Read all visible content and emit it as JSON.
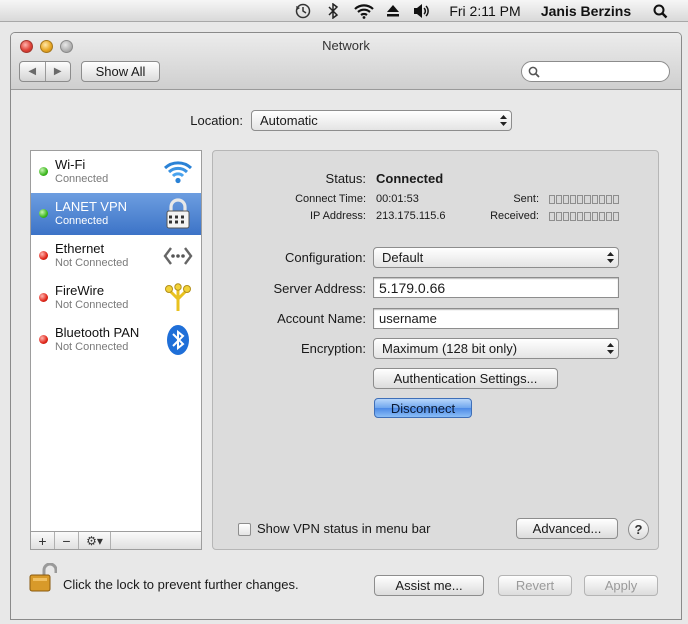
{
  "menubar": {
    "clock": "Fri 2:11 PM",
    "user": "Janis Berzins",
    "icons": [
      "time-machine-icon",
      "bluetooth-icon",
      "wifi-icon",
      "eject-icon",
      "volume-icon",
      "spotlight-icon"
    ]
  },
  "window": {
    "title": "Network",
    "show_all": "Show All",
    "search_placeholder": ""
  },
  "location": {
    "label": "Location:",
    "value": "Automatic"
  },
  "services": [
    {
      "name": "Wi-Fi",
      "status": "Connected",
      "state": "green",
      "icon": "wifi-icon"
    },
    {
      "name": "LANET VPN",
      "status": "Connected",
      "state": "green",
      "icon": "vpn-lock-icon",
      "selected": true
    },
    {
      "name": "Ethernet",
      "status": "Not Connected",
      "state": "red",
      "icon": "ethernet-icon"
    },
    {
      "name": "FireWire",
      "status": "Not Connected",
      "state": "red",
      "icon": "firewire-icon"
    },
    {
      "name": "Bluetooth PAN",
      "status": "Not Connected",
      "state": "red",
      "icon": "bluetooth-icon"
    }
  ],
  "sidebar_tools": {
    "add": "+",
    "remove": "−",
    "gear": "⚙▾"
  },
  "detail": {
    "status_label": "Status:",
    "status_value": "Connected",
    "connect_time_label": "Connect Time:",
    "connect_time_value": "00:01:53",
    "ip_label": "IP Address:",
    "ip_value": "213.175.115.6",
    "sent_label": "Sent:",
    "received_label": "Received:",
    "configuration_label": "Configuration:",
    "configuration_value": "Default",
    "server_label": "Server Address:",
    "server_value": "5.179.0.66",
    "account_label": "Account Name:",
    "account_value": "username",
    "encryption_label": "Encryption:",
    "encryption_value": "Maximum (128 bit only)",
    "auth_button": "Authentication Settings...",
    "disconnect_button": "Disconnect",
    "show_vpn_status": "Show VPN status in menu bar",
    "advanced_button": "Advanced...",
    "help": "?"
  },
  "footer": {
    "lock_text": "Click the lock to prevent further changes.",
    "assist": "Assist me...",
    "revert": "Revert",
    "apply": "Apply"
  }
}
